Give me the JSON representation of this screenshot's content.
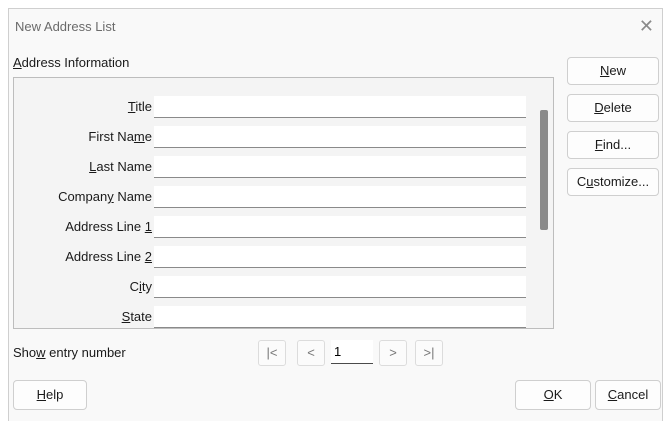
{
  "window": {
    "title": "New Address List",
    "close_icon": "close-icon"
  },
  "section": {
    "title_prefix": "",
    "title_key": "A",
    "title_rest": "ddress Information"
  },
  "fields": [
    {
      "pre": "",
      "key": "T",
      "post": "itle",
      "value": ""
    },
    {
      "pre": "First Na",
      "key": "m",
      "post": "e",
      "value": ""
    },
    {
      "pre": "",
      "key": "L",
      "post": "ast Name",
      "value": ""
    },
    {
      "pre": "Compan",
      "key": "y",
      "post": " Name",
      "value": ""
    },
    {
      "pre": "Address Line ",
      "key": "1",
      "post": "",
      "value": ""
    },
    {
      "pre": "Address Line ",
      "key": "2",
      "post": "",
      "value": ""
    },
    {
      "pre": "C",
      "key": "i",
      "post": "ty",
      "value": ""
    },
    {
      "pre": "",
      "key": "S",
      "post": "tate",
      "value": ""
    }
  ],
  "side_buttons": [
    {
      "pre": "",
      "key": "N",
      "post": "ew"
    },
    {
      "pre": "",
      "key": "D",
      "post": "elete"
    },
    {
      "pre": "",
      "key": "F",
      "post": "ind..."
    },
    {
      "pre": "C",
      "key": "u",
      "post": "stomize..."
    }
  ],
  "navigation": {
    "label_pre": "Sho",
    "label_key": "w",
    "label_post": " entry number",
    "first": "|<",
    "prev": "<",
    "entry_value": "1",
    "next": ">",
    "last": ">|"
  },
  "footer": {
    "help_pre": "",
    "help_key": "H",
    "help_post": "elp",
    "ok_pre": "",
    "ok_key": "O",
    "ok_post": "K",
    "cancel_pre": "",
    "cancel_key": "C",
    "cancel_post": "ancel"
  }
}
